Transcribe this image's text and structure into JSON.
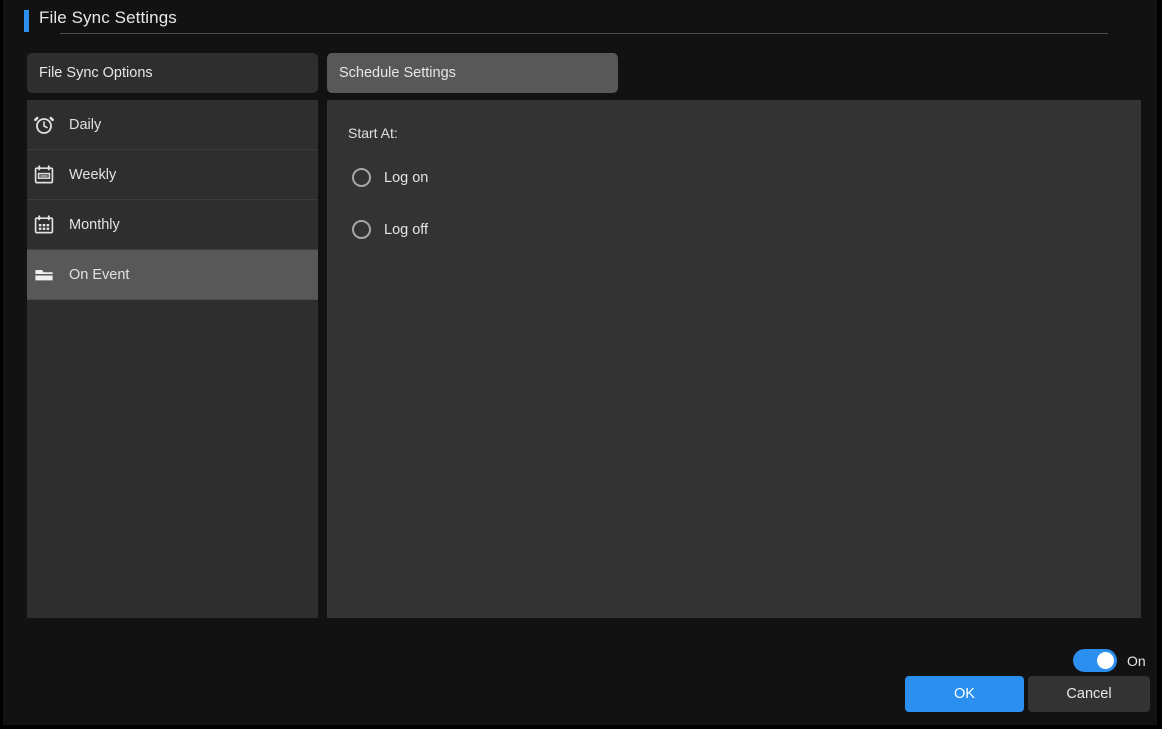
{
  "window": {
    "title": "File Sync Settings",
    "accent_color": "#2a8fef"
  },
  "tabs": [
    {
      "label": "File Sync Options",
      "active": false
    },
    {
      "label": "Schedule Settings",
      "active": true
    }
  ],
  "sidebar": {
    "items": [
      {
        "label": "Daily",
        "icon": "alarm-clock-icon",
        "selected": false
      },
      {
        "label": "Weekly",
        "icon": "calendar-week-icon",
        "selected": false
      },
      {
        "label": "Monthly",
        "icon": "calendar-grid-icon",
        "selected": false
      },
      {
        "label": "On Event",
        "icon": "folder-icon",
        "selected": true
      }
    ]
  },
  "content": {
    "start_at_label": "Start At:",
    "radios": [
      {
        "label": "Log on",
        "selected": false
      },
      {
        "label": "Log off",
        "selected": false
      }
    ]
  },
  "footer": {
    "toggle": {
      "label": "On",
      "state": "on",
      "color": "#2a8fef"
    },
    "ok_label": "OK",
    "cancel_label": "Cancel"
  }
}
